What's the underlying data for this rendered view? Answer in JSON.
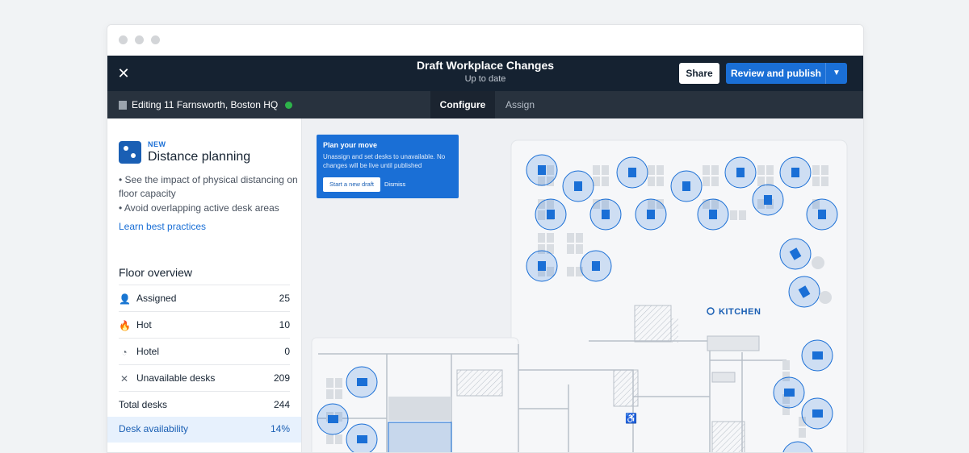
{
  "header": {
    "title": "Draft Workplace Changes",
    "subtitle": "Up to date",
    "share_label": "Share",
    "publish_label": "Review and publish"
  },
  "subbar": {
    "editing_label": "Editing 11 Farnsworth, Boston HQ",
    "tabs": [
      {
        "label": "Configure",
        "active": true
      },
      {
        "label": "Assign",
        "active": false
      }
    ]
  },
  "sidebar": {
    "promo": {
      "badge": "NEW",
      "title": "Distance planning",
      "bullets": [
        "• See the impact of physical distancing on floor capacity",
        "• Avoid overlapping active desk areas"
      ],
      "link": "Learn best practices"
    },
    "floor_overview": {
      "title": "Floor overview",
      "rows": [
        {
          "icon": "assigned-person-icon",
          "label": "Assigned",
          "value": "25"
        },
        {
          "icon": "hot-flame-icon",
          "label": "Hot",
          "value": "10"
        },
        {
          "icon": "hotel-clock-icon",
          "label": "Hotel",
          "value": "0"
        },
        {
          "icon": "unavailable-x-icon",
          "label": "Unavailable desks",
          "value": "209"
        }
      ],
      "total": {
        "label": "Total desks",
        "value": "244"
      },
      "availability": {
        "label": "Desk availability",
        "value": "14%"
      }
    }
  },
  "map": {
    "banner": {
      "title": "Plan your move",
      "body": "Unassign and set desks to unavailable. No changes will be live until published",
      "start_label": "Start a new draft",
      "dismiss_label": "Dismiss"
    },
    "kitchen_label": "KITCHEN"
  },
  "colors": {
    "accent": "#1a6fd6",
    "header_bg": "#152231",
    "subbar_bg": "#28323e",
    "status_green": "#2db34a"
  }
}
